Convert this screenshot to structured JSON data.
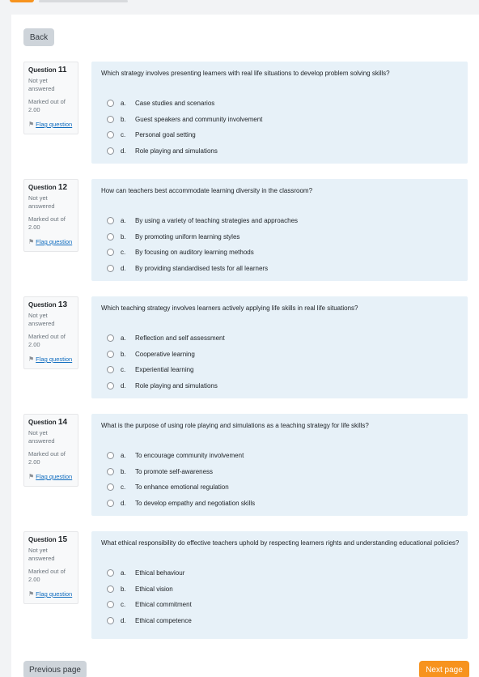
{
  "nav": {
    "back_label": "Back",
    "prev_label": "Previous page",
    "next_label": "Next page"
  },
  "colors": {
    "accent": "#f7931e",
    "question_bg": "#e7f1f8",
    "link": "#0f6cbf"
  },
  "questions": [
    {
      "label": "Question",
      "number": "11",
      "state": "Not yet answered",
      "grade": "Marked out of 2.00",
      "flag": "Flag question",
      "text": "Which strategy involves presenting learners with real life situations to develop problem solving skills?",
      "options": [
        {
          "letter": "a.",
          "text": "Case studies and scenarios"
        },
        {
          "letter": "b.",
          "text": "Guest speakers and community involvement"
        },
        {
          "letter": "c.",
          "text": "Personal goal setting"
        },
        {
          "letter": "d.",
          "text": "Role playing and simulations"
        }
      ]
    },
    {
      "label": "Question",
      "number": "12",
      "state": "Not yet answered",
      "grade": "Marked out of 2.00",
      "flag": "Flag question",
      "text": "How can teachers best accommodate learning diversity in the classroom?",
      "options": [
        {
          "letter": "a.",
          "text": "By using a variety of teaching strategies and approaches"
        },
        {
          "letter": "b.",
          "text": "By promoting uniform learning styles"
        },
        {
          "letter": "c.",
          "text": "By focusing on auditory learning methods"
        },
        {
          "letter": "d.",
          "text": "By providing standardised tests for all learners"
        }
      ]
    },
    {
      "label": "Question",
      "number": "13",
      "state": "Not yet answered",
      "grade": "Marked out of 2.00",
      "flag": "Flag question",
      "text": "Which teaching strategy involves learners actively applying life skills in real life situations?",
      "options": [
        {
          "letter": "a.",
          "text": "Reflection and self assessment"
        },
        {
          "letter": "b.",
          "text": "Cooperative learning"
        },
        {
          "letter": "c.",
          "text": "Experiential learning"
        },
        {
          "letter": "d.",
          "text": "Role playing and simulations"
        }
      ]
    },
    {
      "label": "Question",
      "number": "14",
      "state": "Not yet answered",
      "grade": "Marked out of 2.00",
      "flag": "Flag question",
      "text": "What is the purpose of using role playing and simulations as a teaching strategy for life skills?",
      "options": [
        {
          "letter": "a.",
          "text": "To encourage community involvement"
        },
        {
          "letter": "b.",
          "text": "To promote self-awareness"
        },
        {
          "letter": "c.",
          "text": "To enhance emotional regulation"
        },
        {
          "letter": "d.",
          "text": "To develop empathy and negotiation skills"
        }
      ]
    },
    {
      "label": "Question",
      "number": "15",
      "state": "Not yet answered",
      "grade": "Marked out of 2.00",
      "flag": "Flag question",
      "text": "What ethical responsibility do effective teachers uphold by respecting learners rights and understanding educational policies?",
      "options": [
        {
          "letter": "a.",
          "text": "Ethical behaviour"
        },
        {
          "letter": "b.",
          "text": "Ethical vision"
        },
        {
          "letter": "c.",
          "text": "Ethical commitment"
        },
        {
          "letter": "d.",
          "text": "Ethical competence"
        }
      ]
    }
  ]
}
